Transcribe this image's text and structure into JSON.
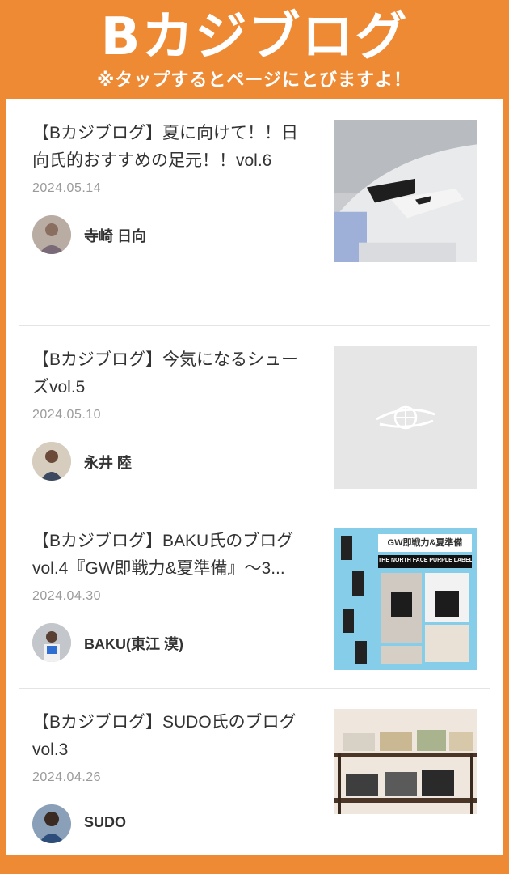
{
  "header": {
    "logo_text": "Bカジブログ",
    "subtitle": "※タップするとページにとびますよ！"
  },
  "posts": [
    {
      "title": "【Bカジブログ】夏に向けて！！日向氏的おすすめの足元！！vol.6",
      "date": "2024.05.14",
      "author": "寺崎 日向",
      "thumb_icon": "sneaker-photo-icon",
      "avatar_icon": "author-avatar-icon"
    },
    {
      "title": "【Bカジブログ】今気になるシューズvol.5",
      "date": "2024.05.10",
      "author": "永井 陸",
      "thumb_icon": "brand-logo-placeholder-icon",
      "avatar_icon": "author-avatar-icon"
    },
    {
      "title": "【Bカジブログ】BAKU氏のブログvol.4『GW即戦力&夏準備』〜3...",
      "date": "2024.04.30",
      "author": "BAKU(東江 漠)",
      "thumb_icon": "outfit-collage-photo-icon",
      "avatar_icon": "author-avatar-icon"
    },
    {
      "title": "【Bカジブログ】SUDO氏のブログvol.3",
      "date": "2024.04.26",
      "author": "SUDO",
      "thumb_icon": "folded-pants-photo-icon",
      "avatar_icon": "author-avatar-icon"
    }
  ],
  "thumb_text": {
    "banner_title": "GW即戦力&夏準備",
    "banner_subtitle": "THE NORTH FACE PURPLE LABEL"
  },
  "colors": {
    "brand_orange": "#ef8a34",
    "panel_white": "#ffffff",
    "text_dark": "#333333",
    "date_gray": "#9a9a9a"
  }
}
